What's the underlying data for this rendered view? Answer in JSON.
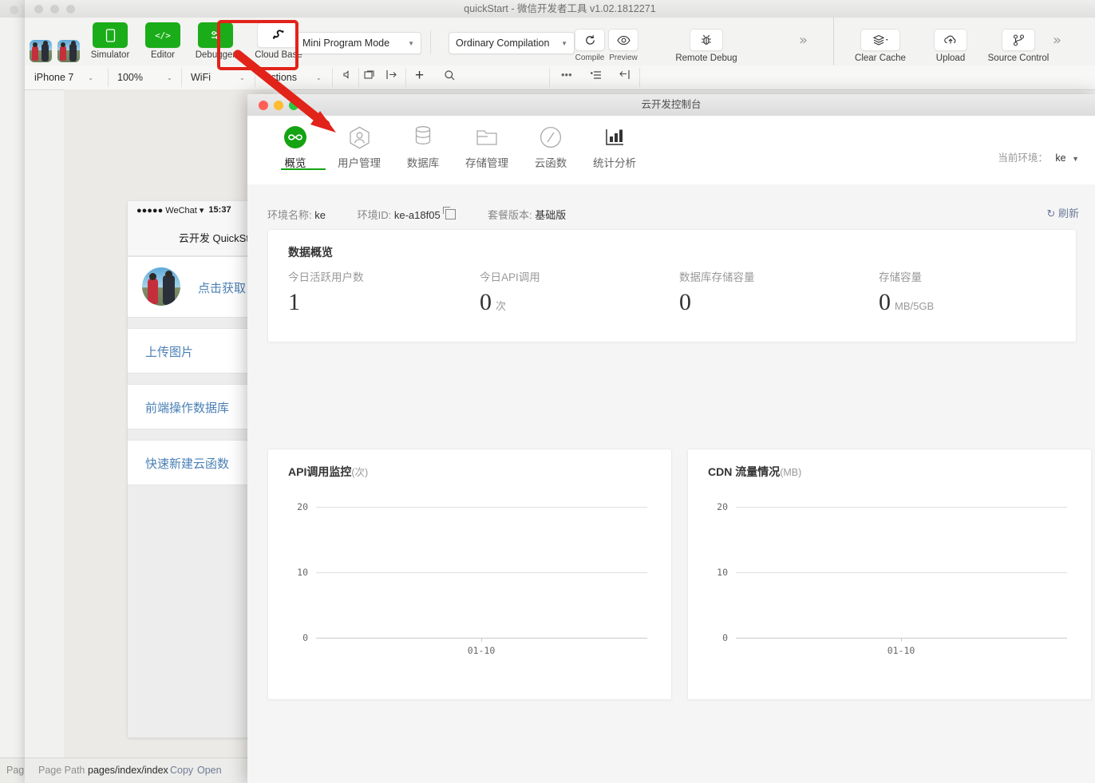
{
  "background_window": {
    "status_text": "Pag"
  },
  "ide": {
    "title": "quickStart - 微信开发者工具 v1.02.1812271",
    "toolbar": [
      {
        "label": "Simulator",
        "icon": "phone-icon",
        "style": "green"
      },
      {
        "label": "Editor",
        "icon": "code-icon",
        "style": "green"
      },
      {
        "label": "Debugger",
        "icon": "debugger-icon",
        "style": "green"
      },
      {
        "label": "Cloud Base",
        "icon": "cloud-base-icon",
        "style": "white"
      }
    ],
    "mode_select": "Mini Program Mode",
    "compilation_select": "Ordinary Compilation",
    "compile_label": "Compile",
    "preview_label": "Preview",
    "remote_debug_label": "Remote Debug",
    "right_tools": [
      {
        "label": "Clear Cache",
        "icon": "layers-icon"
      },
      {
        "label": "Upload",
        "icon": "cloud-upload-icon"
      },
      {
        "label": "Source Control",
        "icon": "source-control-icon"
      }
    ],
    "overflow_icon": "chevron-double-right-icon",
    "sim_toolbar": {
      "device": "iPhone 7",
      "zoom": "100%",
      "network": "WiFi",
      "actions": "Actions",
      "icons": [
        "volume-icon",
        "multi-window-icon",
        "panel-toggle-icon",
        "plus-icon",
        "search-icon",
        "more-icon",
        "list-icon",
        "collapse-icon"
      ]
    },
    "status_bar": {
      "page_path_label": "Page Path",
      "page_path_value": "pages/index/index",
      "copy_label": "Copy",
      "open_label": "Open"
    }
  },
  "simulator": {
    "carrier": "WeChat",
    "signal": "●●●●●",
    "wifi_icon": "wifi-icon",
    "time": "15:37",
    "nav_title": "云开发 QuickStart",
    "cells": [
      {
        "text": "点击获取 openid",
        "has_avatar": true
      },
      {
        "text": "上传图片",
        "has_avatar": false
      },
      {
        "text": "前端操作数据库",
        "has_avatar": false
      },
      {
        "text": "快速新建云函数",
        "has_avatar": false
      }
    ]
  },
  "cloud_console": {
    "title": "云开发控制台",
    "nav": [
      {
        "label": "概览",
        "icon": "infinity-icon",
        "active": true
      },
      {
        "label": "用户管理",
        "icon": "user-icon",
        "active": false
      },
      {
        "label": "数据库",
        "icon": "database-icon",
        "active": false
      },
      {
        "label": "存储管理",
        "icon": "folder-icon",
        "active": false
      },
      {
        "label": "云函数",
        "icon": "function-icon",
        "active": false
      },
      {
        "label": "统计分析",
        "icon": "bar-chart-icon",
        "active": false
      }
    ],
    "current_env_label": "当前环境：",
    "current_env_value": "ke",
    "env_name_label": "环境名称:",
    "env_name_value": "ke",
    "env_id_label": "环境ID:",
    "env_id_value": "ke-a18f05",
    "copy_icon": "copy-icon",
    "plan_label": "套餐版本:",
    "plan_value": "基础版",
    "refresh_label": "刷新",
    "refresh_icon": "refresh-icon",
    "overview": {
      "title": "数据概览",
      "stats": [
        {
          "label": "今日活跃用户数",
          "value": "1",
          "unit": ""
        },
        {
          "label": "今日API调用",
          "value": "0",
          "unit": "次"
        },
        {
          "label": "数据库存储容量",
          "value": "0",
          "unit": ""
        },
        {
          "label": "存储容量",
          "value": "0",
          "unit": "MB/5GB"
        }
      ]
    },
    "accent_green": "#14a312",
    "link_blue": "#4a7fb5"
  },
  "chart_data": [
    {
      "type": "line",
      "title": "API调用监控",
      "unit": "(次)",
      "xlabel": "",
      "ylabel": "",
      "ylim": [
        0,
        20
      ],
      "yticks": [
        0,
        10,
        20
      ],
      "x": [
        "01-10"
      ],
      "values": [
        0
      ],
      "grid": true,
      "legend": "none"
    },
    {
      "type": "line",
      "title": "CDN 流量情况",
      "unit": "(MB)",
      "xlabel": "",
      "ylabel": "",
      "ylim": [
        0,
        20
      ],
      "yticks": [
        0,
        10,
        20
      ],
      "x": [
        "01-10"
      ],
      "values": [
        0
      ],
      "grid": true,
      "legend": "none"
    }
  ]
}
